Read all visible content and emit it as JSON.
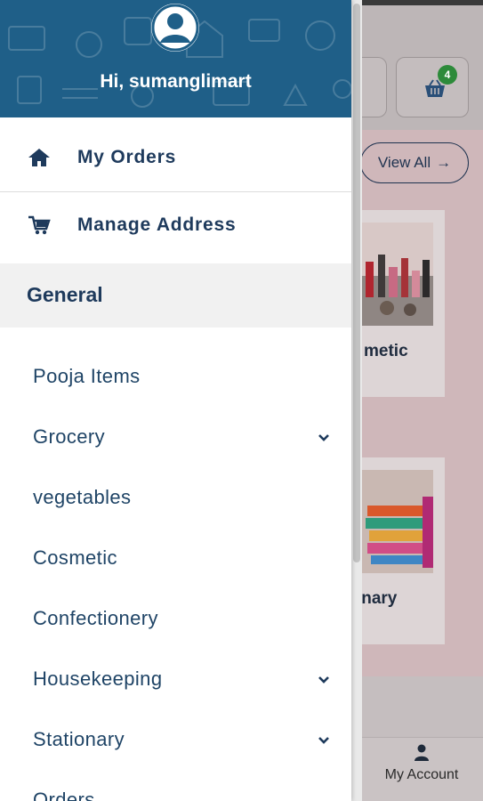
{
  "drawer": {
    "greeting": "Hi, sumanglimart",
    "menu": [
      {
        "label": "My Orders",
        "icon": "home-icon"
      },
      {
        "label": "Manage Address",
        "icon": "cart-icon"
      }
    ],
    "section_title": "General",
    "categories": [
      {
        "label": "Pooja Items",
        "expandable": false
      },
      {
        "label": "Grocery",
        "expandable": true
      },
      {
        "label": "vegetables",
        "expandable": false
      },
      {
        "label": "Cosmetic",
        "expandable": false
      },
      {
        "label": "Confectionery",
        "expandable": false
      },
      {
        "label": "Housekeeping",
        "expandable": true
      },
      {
        "label": "Stationary",
        "expandable": true
      },
      {
        "label": "Orders",
        "expandable": false
      }
    ]
  },
  "background": {
    "cart_count": "4",
    "view_all_label": "View All",
    "card_labels": [
      "metic",
      "tionary"
    ],
    "bottom_nav_account": "My Account"
  },
  "colors": {
    "header_bg": "#1f5f88",
    "text_primary": "#1e3a5c",
    "badge_green": "#2d8a3a",
    "overlay_content": "#cfb7ba"
  }
}
